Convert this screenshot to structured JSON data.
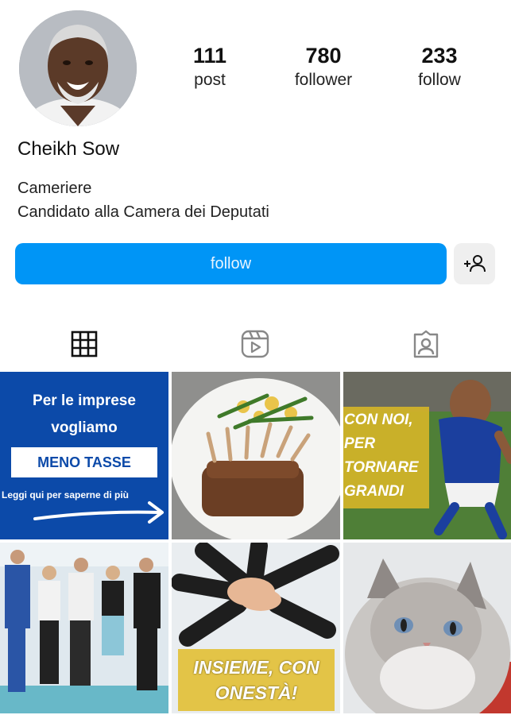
{
  "profile": {
    "name": "Cheikh Sow",
    "bio_line1": "Cameriere",
    "bio_line2": "Candidato alla Camera dei Deputati"
  },
  "stats": [
    {
      "value": "111",
      "label": "post"
    },
    {
      "value": "780",
      "label": "follower"
    },
    {
      "value": "233",
      "label": "follow"
    }
  ],
  "actions": {
    "follow_label": "follow",
    "add_user_icon": "person-plus-icon"
  },
  "tabs": [
    {
      "icon": "grid-icon",
      "active": true
    },
    {
      "icon": "reels-icon",
      "active": false
    },
    {
      "icon": "tagged-icon",
      "active": false
    }
  ],
  "posts": {
    "post1": {
      "line1": "Per le imprese",
      "line2": "vogliamo",
      "highlight": "MENO TASSE",
      "cta": "Leggi qui per saperne di più"
    },
    "post3": {
      "text_lines": [
        "CON NOI,",
        "PER",
        "TORNARE",
        "GRANDI"
      ]
    },
    "post5": {
      "line1": "INSIEME, CON",
      "line2": "ONESTÀ!"
    }
  },
  "colors": {
    "accent": "#0095f6",
    "post1_bg": "#0c4aa9",
    "post5_banner": "#e3c447",
    "post3_box": "#d4b428"
  }
}
